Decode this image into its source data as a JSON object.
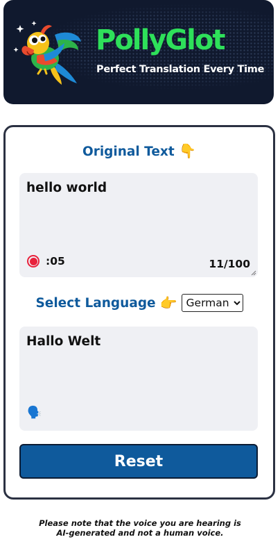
{
  "header": {
    "title": "PollyGlot",
    "subtitle": "Perfect Translation Every Time"
  },
  "original": {
    "title": "Original Text",
    "title_emoji": "👇",
    "text": "hello world",
    "timer": ":05",
    "char_count": "11/100",
    "record_icon": "record-icon"
  },
  "language": {
    "label": "Select Language",
    "label_emoji": "👉",
    "selected": "German"
  },
  "translation": {
    "text": "Hallo Welt",
    "speaker_emoji": "🗣️"
  },
  "reset_label": "Reset",
  "disclaimer": {
    "line1": "Please note that the voice you are hearing is",
    "line2": "AI-generated and not a human voice."
  },
  "colors": {
    "header_bg": "#10192e",
    "brand_green": "#2ee05a",
    "accent_blue": "#0f5a9c",
    "record_red": "#e8213b",
    "textbox_bg": "#eff0f4"
  }
}
